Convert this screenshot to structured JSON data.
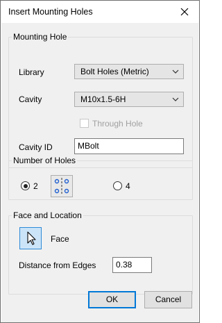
{
  "window": {
    "title": "Insert Mounting Holes"
  },
  "mounting_hole": {
    "legend": "Mounting Hole",
    "library_label": "Library",
    "library_value": "Bolt Holes (Metric)",
    "cavity_label": "Cavity",
    "cavity_value": "M10x1.5-6H",
    "through_hole_label": "Through Hole",
    "through_hole_checked": false,
    "cavity_id_label": "Cavity ID",
    "cavity_id_value": "MBolt"
  },
  "number_of_holes": {
    "legend": "Number of Holes",
    "option_2_label": "2",
    "option_2_selected": true,
    "option_4_label": "4",
    "option_4_selected": false
  },
  "face_and_location": {
    "legend": "Face and Location",
    "face_label": "Face",
    "distance_label": "Distance from Edges",
    "distance_value": "0.38"
  },
  "buttons": {
    "ok_label": "OK",
    "cancel_label": "Cancel"
  },
  "colors": {
    "accent": "#0078d7",
    "hole_blue": "#1f5fd1"
  }
}
